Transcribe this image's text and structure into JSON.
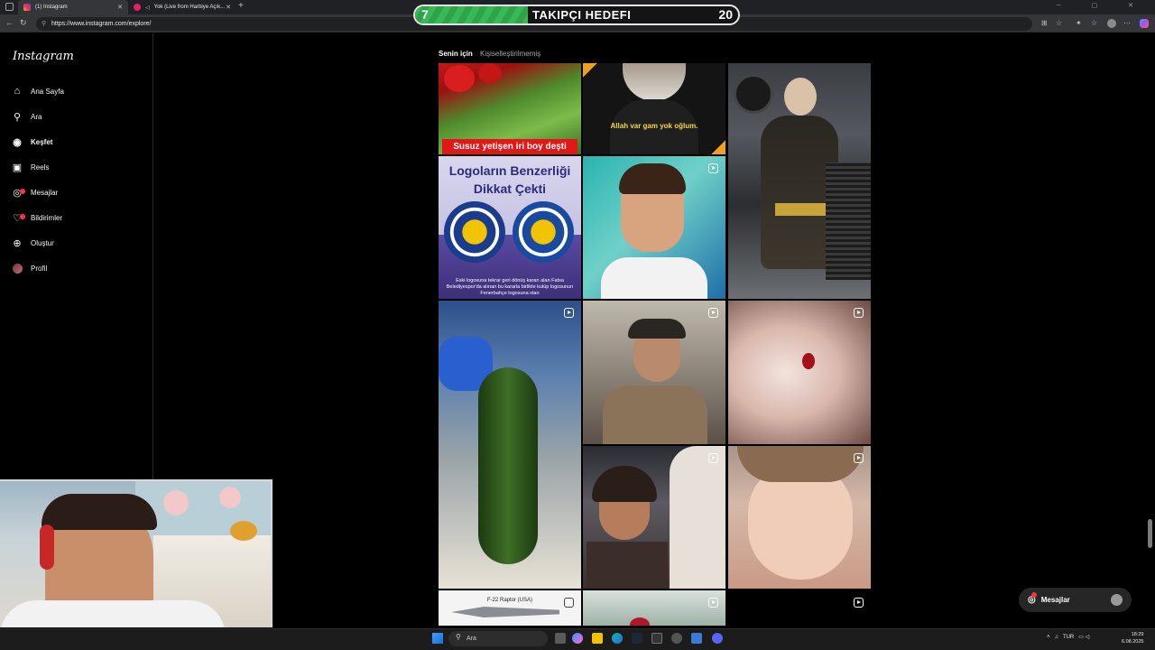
{
  "browser": {
    "tabs": [
      {
        "title": "(1) Instagram",
        "active": true
      },
      {
        "title": "Yok (Live from Harbiye Açık...",
        "active": false
      }
    ],
    "url": "https://www.instagram.com/explore/"
  },
  "goal_overlay": {
    "current": "7",
    "title": "TAKIPÇI HEDEFI",
    "target": "20",
    "progress": 0.35
  },
  "instagram": {
    "logo": "Instagram",
    "nav": [
      {
        "label": "Ana Sayfa",
        "icon": "home-icon"
      },
      {
        "label": "Ara",
        "icon": "search-icon"
      },
      {
        "label": "Keşfet",
        "icon": "compass-icon",
        "active": true
      },
      {
        "label": "Reels",
        "icon": "reels-icon"
      },
      {
        "label": "Mesajlar",
        "icon": "messenger-icon",
        "badge": true
      },
      {
        "label": "Bildirimler",
        "icon": "heart-icon",
        "badge": true
      },
      {
        "label": "Oluştur",
        "icon": "plus-square-icon"
      },
      {
        "label": "Profil",
        "icon": "avatar-icon"
      }
    ],
    "feed_tabs": {
      "for_you": "Senin için",
      "non_personalized": "Kişiselleştirilmemiş"
    },
    "posts": {
      "tomato_caption": "Susuz yetişen iri boy deşti",
      "oldman_caption": "Allah var gam yok oğlum.",
      "logo_title": "Logoların Benzerliği Dikkat Çekti",
      "logo_note": "Eski logosuna tekrar geri dönüş kararı alan Fatsa Belediyespor'da alınan bu kararla birlikte kulüp logosunun Fenerbahçe logosuna olan",
      "plane_label": "F-22 Raptor (USA)"
    },
    "messages_pill": "Mesajlar"
  },
  "taskbar": {
    "search": "Ara",
    "lang": "TUR",
    "time": "18:29",
    "date": "6.08.2025"
  },
  "colors": {
    "goal_green": "#39b856",
    "notification_red": "#ff3040",
    "ig_background": "#000000"
  }
}
